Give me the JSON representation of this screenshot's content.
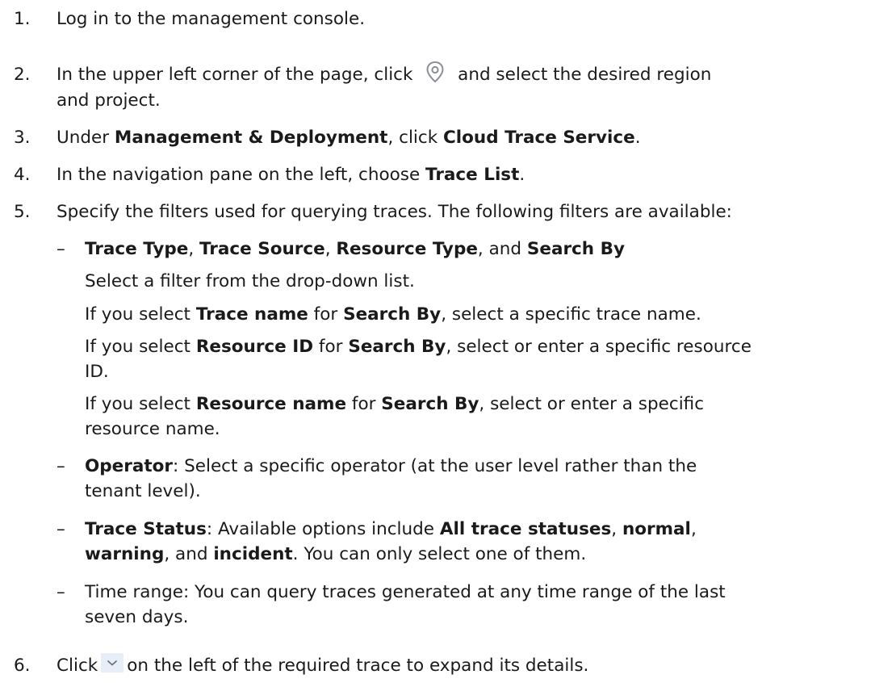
{
  "steps": [
    {
      "num": "1.",
      "text": "Log in to the management console."
    },
    {
      "num": "2.",
      "before": "In the upper left corner of the page, click",
      "after": "and select the desired region",
      "line2": "and project.",
      "icon": "location-pin-icon"
    },
    {
      "num": "3.",
      "t1": "Under ",
      "b1": "Management & Deployment",
      "t2": ", click ",
      "b2": "Cloud Trace Service",
      "t3": "."
    },
    {
      "num": "4.",
      "t1": "In the navigation pane on the left, choose ",
      "b1": "Trace List",
      "t2": "."
    },
    {
      "num": "5.",
      "text": "Specify the filters used for querying traces. The following filters are available:"
    },
    {
      "num": "6.",
      "before": "Click",
      "after": "on the left of the required trace to expand its details.",
      "icon": "chevron-down-icon"
    }
  ],
  "filters": {
    "dash": "–",
    "item1": {
      "b1": "Trace Type",
      "t1": ", ",
      "b2": "Trace Source",
      "t2": ", ",
      "b3": "Resource Type",
      "t3": ", and ",
      "b4": "Search By",
      "p1": "Select a filter from the drop-down list.",
      "p2": {
        "t1": "If you select ",
        "b1": "Trace name",
        "t2": " for ",
        "b2": "Search By",
        "t3": ", select a specific trace name."
      },
      "p3": {
        "t1": "If you select ",
        "b1": "Resource ID",
        "t2": " for ",
        "b2": "Search By",
        "t3": ", select or enter a specific resource",
        "line2": "ID."
      },
      "p4": {
        "t1": "If you select ",
        "b1": "Resource name",
        "t2": " for ",
        "b2": "Search By",
        "t3": ", select or enter a specific",
        "line2": "resource name."
      }
    },
    "item2": {
      "b1": "Operator",
      "t1": ": Select a specific operator (at the user level rather than the",
      "line2": "tenant level)."
    },
    "item3": {
      "b1": "Trace Status",
      "t1": ": Available options include ",
      "b2": "All trace statuses",
      "t2": ", ",
      "b3": "normal",
      "t3": ",",
      "b4": "warning",
      "t4": ", and ",
      "b5": "incident",
      "t5": ". You can only select one of them."
    },
    "item4": {
      "t1": "Time range: You can query traces generated at any time range of the last",
      "line2": "seven days."
    }
  },
  "colors": {
    "text": "#1a1a1a",
    "chevron_bg": "#e7eef7",
    "icon_stroke": "#8a8f96"
  }
}
